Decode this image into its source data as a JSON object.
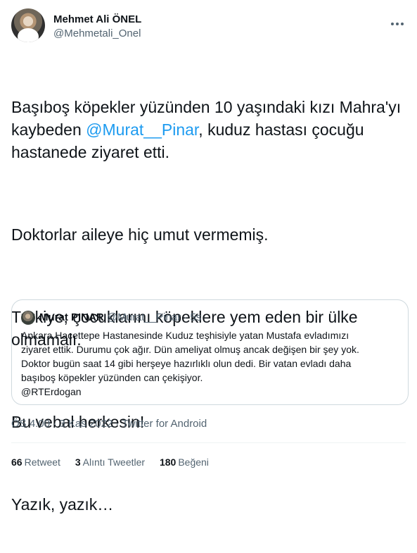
{
  "author": {
    "name": "Mehmet Ali ÖNEL",
    "handle": "@Mehmetali_Onel"
  },
  "tweet": {
    "line1": "Başıboş köpekler yüzünden 10 yaşındaki kızı Mahra'yı",
    "line2_pre": "kaybeden ",
    "mention": "@Murat__Pinar",
    "line2_post": ", kuduz hastası çocuğu",
    "line3": "hastanede ziyaret etti.",
    "para2": "Doktorlar aileye hiç umut vermemiş.",
    "para3_line1": "Turkiye, çocuklarını köpeklere yem eden bir ülke",
    "para3_line2": "olmamalı.",
    "para4": "Bu vebal herkesin!",
    "para5": "Yazık, yazık…"
  },
  "quote": {
    "name": "Murat PINAR",
    "handle": "@Murat__Pinar",
    "separator": "·",
    "time": "5s",
    "lines": [
      "Ankara Hacettepe Hastanesinde Kuduz teşhisiyle yatan Mustafa evladımızı",
      "ziyaret ettik. Durumu çok ağır. Dün ameliyat olmuş ancak değişen bir şey yok.",
      "Doktor bugün saat 14 gibi herşeye hazırlıklı olun dedi. Bir vatan evladı daha",
      "başıboş köpekler yüzünden can çekişiyor.",
      "@RTErdogan"
    ]
  },
  "meta": {
    "timestamp": "ÖS 4:00 · 3 Kas 2022 · Twitter for Android"
  },
  "stats": {
    "retweets_count": "66",
    "retweets_label": "Retweet",
    "quotes_count": "3",
    "quotes_label": "Alıntı Tweetler",
    "likes_count": "180",
    "likes_label": "Beğeni"
  },
  "icons": {
    "more": "more-horizontal-icon"
  },
  "colors": {
    "link": "#1d9bf0",
    "secondary_text": "#536471",
    "border": "#cfd9de"
  }
}
